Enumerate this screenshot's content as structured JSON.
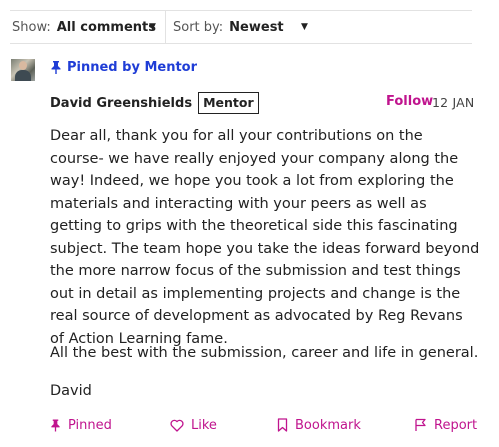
{
  "filters": {
    "show_label": "Show:",
    "show_value": "All comments",
    "sort_label": "Sort by:",
    "sort_value": "Newest"
  },
  "comment": {
    "pinned_label": "Pinned by Mentor",
    "author": "David Greenshields",
    "role": "Mentor",
    "follow_label": "Follow",
    "date": "12 JAN",
    "body": {
      "p1": "Dear all, thank you for all your contributions on the course- we have really enjoyed your company along the way! Indeed, we hope you took a lot from exploring the materials and interacting with your peers as well as getting to grips with the theoretical side this fascinating subject. The team hope you take the ideas forward beyond the more narrow focus of the submission and test things out in detail as implementing projects and change is the real source of development as advocated by Reg Revans of Action Learning fame.",
      "p2": "All the best with the submission, career and life in general.",
      "p3": "David"
    },
    "actions": {
      "pinned": "Pinned",
      "like": "Like",
      "bookmark": "Bookmark",
      "report": "Report"
    }
  },
  "colors": {
    "accent": "#c0148e",
    "pinned_banner": "#1f3dd6"
  }
}
